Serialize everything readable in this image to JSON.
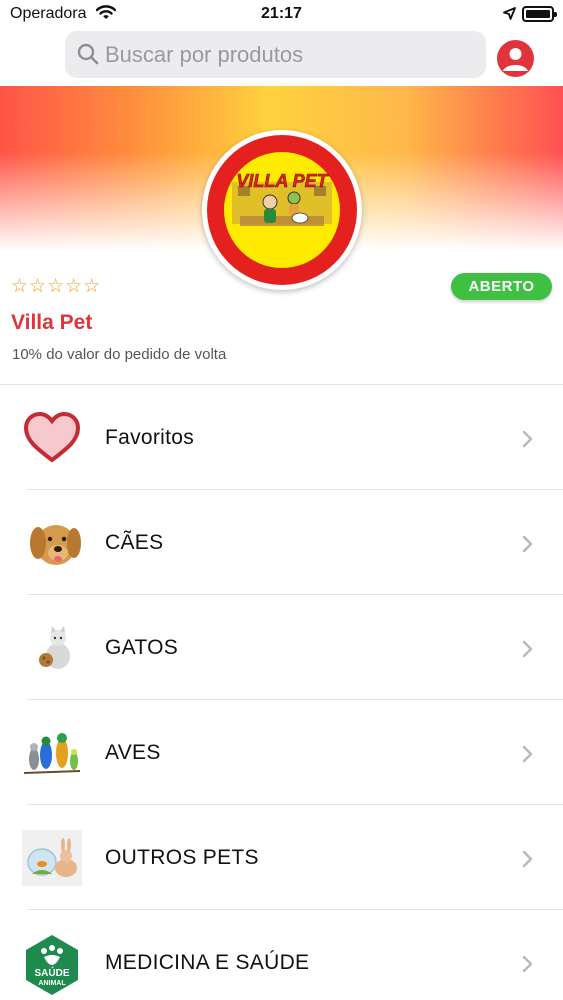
{
  "status_bar": {
    "carrier": "Operadora",
    "time": "21:17"
  },
  "search": {
    "placeholder": "Buscar por produtos"
  },
  "store": {
    "logo_text": "VILLA PET",
    "rating_stars": "☆☆☆☆☆",
    "rating_value": 0,
    "status": "ABERTO",
    "name": "Villa Pet",
    "cashback": "10% do valor do pedido de volta"
  },
  "menu": {
    "items": [
      {
        "label": "Favoritos",
        "icon": "heart-icon"
      },
      {
        "label": "CÃES",
        "icon": "dog-icon"
      },
      {
        "label": "GATOS",
        "icon": "cat-icon"
      },
      {
        "label": "AVES",
        "icon": "parrot-icon"
      },
      {
        "label": "OUTROS PETS",
        "icon": "fishbowl-rabbit-icon"
      },
      {
        "label": "MEDICINA E SAÚDE",
        "icon": "saude-animal-icon",
        "icon_text_1": "SAÚDE",
        "icon_text_2": "ANIMAL"
      }
    ]
  },
  "colors": {
    "accent": "#e0343a",
    "open_badge": "#3fc043",
    "search_bg": "#ececee"
  }
}
